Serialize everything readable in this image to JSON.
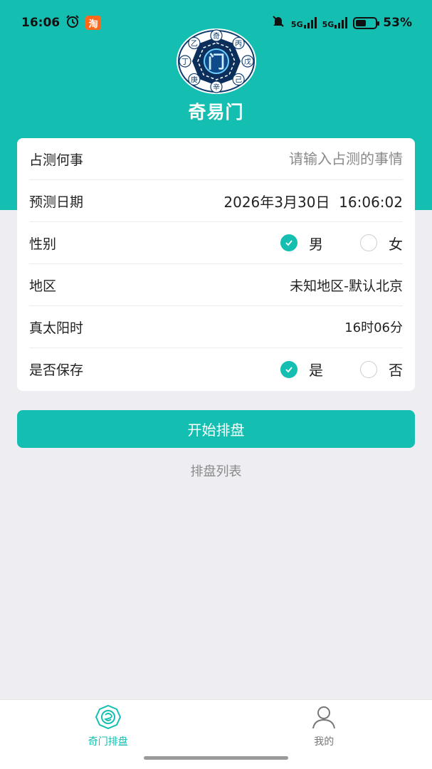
{
  "status_bar": {
    "time": "16:06",
    "taobao_badge": "淘",
    "signal_1": "5G",
    "signal_2": "5G",
    "battery_percent": "53%",
    "battery_level": 0.53
  },
  "header": {
    "logo_center": "门",
    "logo_chars": [
      "奇",
      "丙",
      "戊",
      "己",
      "辛",
      "庚",
      "丁",
      "乙"
    ],
    "title": "奇易门"
  },
  "form": {
    "matter_label": "占测何事",
    "matter_placeholder": "请输入占测的事情",
    "matter_value": "",
    "date_label": "预测日期",
    "date_value": "2026年3月30日  16:06:02",
    "gender_label": "性别",
    "gender_options": [
      "男",
      "女"
    ],
    "gender_selected": "男",
    "region_label": "地区",
    "region_value": "未知地区-默认北京",
    "solar_label": "真太阳时",
    "solar_value": "16时06分",
    "save_label": "是否保存",
    "save_options": [
      "是",
      "否"
    ],
    "save_selected": "是"
  },
  "actions": {
    "start_label": "开始排盘",
    "list_label": "排盘列表"
  },
  "tab_bar": {
    "tabs": [
      {
        "label": "奇门排盘",
        "icon": "qimen-icon",
        "active": true
      },
      {
        "label": "我的",
        "icon": "user-icon",
        "active": false
      }
    ]
  },
  "colors": {
    "accent": "#14bfb1",
    "background": "#eeeef2",
    "placeholder": "#8a8a8a"
  }
}
